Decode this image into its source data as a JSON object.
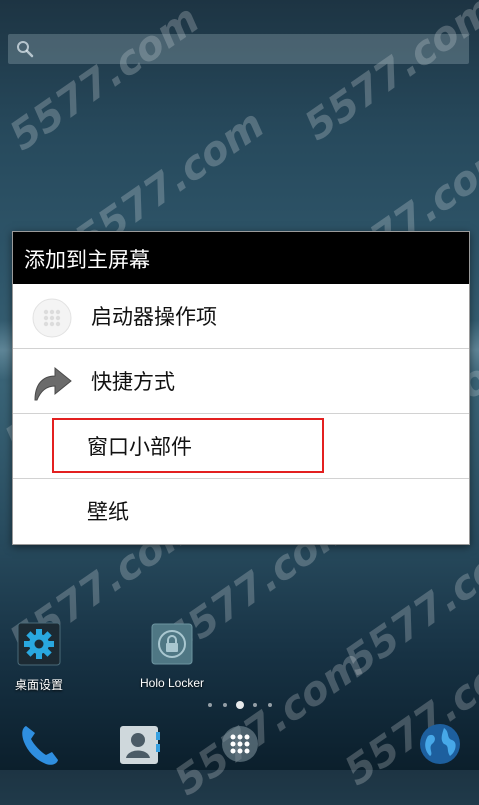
{
  "watermark": "5577.com",
  "dialog": {
    "title": "添加到主屏幕",
    "items": [
      {
        "label": "启动器操作项",
        "icon": "launcher-dots-icon"
      },
      {
        "label": "快捷方式",
        "icon": "shortcut-arrow-icon"
      },
      {
        "label": "窗口小部件",
        "icon": ""
      },
      {
        "label": "壁纸",
        "icon": ""
      }
    ],
    "highlighted_item": "窗口小部件"
  },
  "home": {
    "apps": [
      {
        "label": "桌面设置",
        "icon": "gear-icon"
      },
      {
        "label": "Holo Locker",
        "icon": "lock-icon"
      }
    ],
    "page_indicator": {
      "pages": 5,
      "current": 3
    },
    "dock": [
      {
        "icon": "phone-icon"
      },
      {
        "icon": "contacts-icon"
      },
      {
        "icon": "app-drawer-icon"
      },
      {
        "icon": "browser-globe-icon"
      }
    ]
  },
  "colors": {
    "highlight": "#e32020",
    "dialog_title_bg": "#000000"
  }
}
